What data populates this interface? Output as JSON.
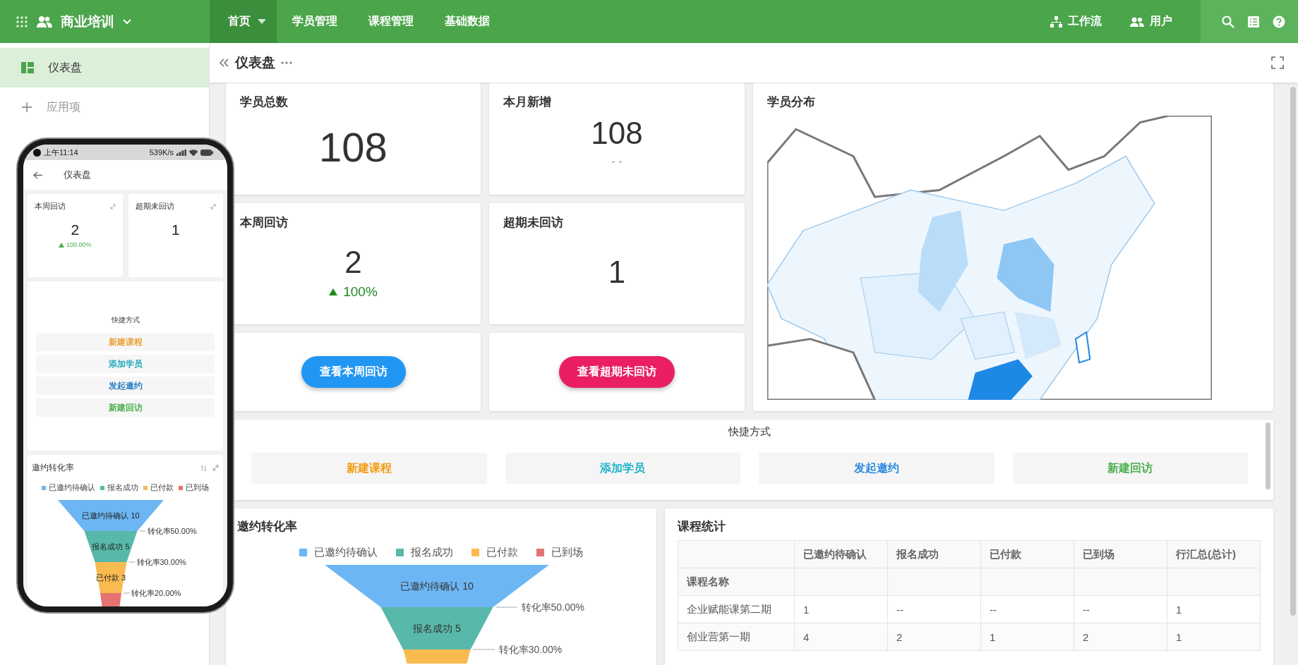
{
  "topbar": {
    "app_name": "商业培训",
    "nav": [
      {
        "label": "首页",
        "selected": true,
        "dropdown": true
      },
      {
        "label": "学员管理",
        "selected": false,
        "dropdown": false
      },
      {
        "label": "课程管理",
        "selected": false,
        "dropdown": false
      },
      {
        "label": "基础数据",
        "selected": false,
        "dropdown": false
      }
    ],
    "links": [
      {
        "label": "工作流",
        "kind": "workflow"
      },
      {
        "label": "用户",
        "kind": "users"
      }
    ]
  },
  "sidebar": {
    "items": [
      {
        "label": "仪表盘",
        "kind": "dashboard",
        "selected": true
      },
      {
        "label": "应用项",
        "kind": "add",
        "selected": false
      }
    ]
  },
  "page": {
    "title": "仪表盘"
  },
  "stats": [
    {
      "title": "学员总数",
      "value": "108"
    },
    {
      "title": "本月新增",
      "value": "108",
      "note": "- -"
    },
    {
      "title": "本周回访",
      "value": "2",
      "trend": "100%"
    },
    {
      "title": "超期未回访",
      "value": "1"
    }
  ],
  "actions": [
    {
      "label": "查看本周回访",
      "color": "#2196f3"
    },
    {
      "label": "查看超期未回访",
      "color": "#e91e63"
    }
  ],
  "map": {
    "title": "学员分布",
    "kind": "picture"
  },
  "shortcuts": {
    "title": "快捷方式",
    "items": [
      {
        "label": "新建课程",
        "color": "#f39c12"
      },
      {
        "label": "添加学员",
        "color": "#1fb5c9"
      },
      {
        "label": "发起邀约",
        "color": "#2d8ce0"
      },
      {
        "label": "新建回访",
        "color": "#4caf50"
      }
    ]
  },
  "conversion": {
    "title": "邀约转化率",
    "legend": [
      {
        "label": "已邀约待确认",
        "color": "#6cb6f3"
      },
      {
        "label": "报名成功",
        "color": "#58b8aa"
      },
      {
        "label": "已付款",
        "color": "#f9bb50"
      },
      {
        "label": "已到场",
        "color": "#e57373"
      }
    ],
    "stages": [
      "已邀约待确认 10",
      "报名成功 5"
    ],
    "rates": [
      "转化率50.00%",
      "转化率30.00%"
    ]
  },
  "course_stats": {
    "title": "课程统计",
    "columns": [
      "已邀约待确认",
      "报名成功",
      "已付款",
      "已到场",
      "行汇总(总计)"
    ],
    "row_header": "课程名称",
    "rows": [
      {
        "name": "企业赋能课第二期",
        "cells": [
          "1",
          "--",
          "--",
          "--",
          "1"
        ]
      },
      {
        "name": "创业营第一期",
        "cells": [
          "4",
          "2",
          "1",
          "2",
          "1"
        ]
      }
    ]
  },
  "phone": {
    "status": {
      "time": "上午11:14",
      "speed": "539K/s"
    },
    "title": "仪表盘",
    "stats": [
      {
        "title": "本周回访",
        "value": "2",
        "trend": "100.00%"
      },
      {
        "title": "超期未回访",
        "value": "1"
      }
    ],
    "shortcuts": {
      "title": "快捷方式",
      "items": [
        {
          "label": "新建课程",
          "color": "#e8a33a"
        },
        {
          "label": "添加学员",
          "color": "#22a9c0"
        },
        {
          "label": "发起邀约",
          "color": "#2b7fc4"
        },
        {
          "label": "新建回访",
          "color": "#4caf50"
        }
      ]
    },
    "conversion": {
      "title": "邀约转化率",
      "legend": [
        {
          "label": "已邀约待确认",
          "color": "#6cb6f3"
        },
        {
          "label": "报名成功",
          "color": "#58b8aa"
        },
        {
          "label": "已付款",
          "color": "#f9bb50"
        },
        {
          "label": "已到场",
          "color": "#e57373"
        }
      ],
      "stages": [
        "已邀约待确认 10",
        "报名成功 5",
        "已付款 3"
      ],
      "rates": [
        "转化率50.00%",
        "转化率30.00%",
        "转化率20.00%"
      ]
    }
  }
}
